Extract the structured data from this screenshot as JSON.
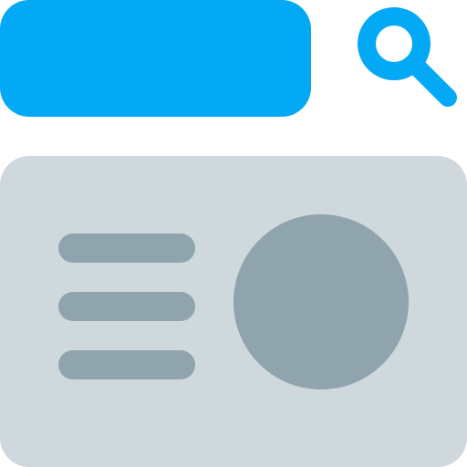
{
  "colors": {
    "accent": "#03A9F4",
    "card_background": "#CFD8DC",
    "placeholder": "#90A4AE",
    "inner": "#FFFFFF"
  },
  "icons": {
    "search": "search-icon"
  },
  "card": {
    "text_line_count": 3
  }
}
